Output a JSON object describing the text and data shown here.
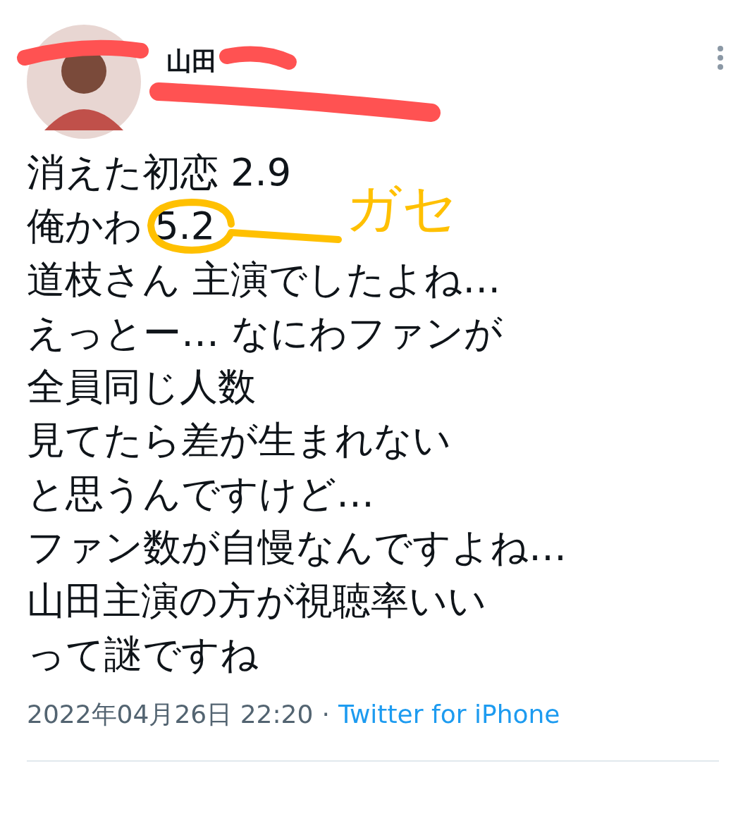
{
  "author": {
    "name": "山田"
  },
  "tweet": {
    "lines": [
      "消えた初恋 2.9",
      "俺かわ 5.2",
      "道枝さん 主演でしたよね…",
      "えっとー… なにわファンが",
      "全員同じ人数",
      "見てたら差が生まれない",
      "と思うんですけど…",
      "ファン数が自慢なんですよね…",
      "山田主演の方が視聴率いい",
      "って謎ですね"
    ]
  },
  "meta": {
    "timestamp": "2022年04月26日 22:20",
    "separator": "·",
    "source": "Twitter for iPhone"
  },
  "annotation": {
    "text": "ガセ"
  }
}
